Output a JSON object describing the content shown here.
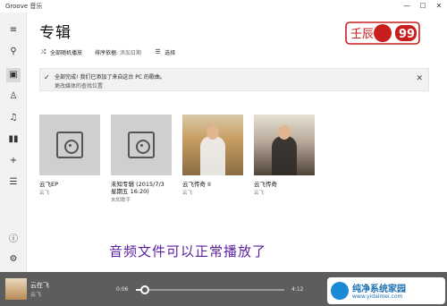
{
  "window": {
    "app_title": "Groove 音乐",
    "controls": [
      "—",
      "☐",
      "✕"
    ]
  },
  "rail": {
    "items": [
      {
        "name": "menu",
        "glyph": "≡"
      },
      {
        "name": "search",
        "glyph": "⚲"
      },
      {
        "name": "albums",
        "glyph": "▣"
      },
      {
        "name": "artists",
        "glyph": "♙"
      },
      {
        "name": "songs",
        "glyph": "♫"
      },
      {
        "name": "now-playing",
        "glyph": "▮▮"
      },
      {
        "name": "new-playlist",
        "glyph": "+"
      },
      {
        "name": "playlists",
        "glyph": "☰"
      },
      {
        "name": "account",
        "glyph": "ⓘ"
      },
      {
        "name": "settings",
        "glyph": "⚙"
      }
    ]
  },
  "page": {
    "title": "专辑"
  },
  "logo": {
    "text_left": "壬辰",
    "text_right": "99",
    "accent": "#c81e1e"
  },
  "commands": {
    "shuffle_label": "全部随机播放",
    "sort_label": "排序依据:",
    "sort_value": "添加日期",
    "select_label": "选择"
  },
  "banner": {
    "message": "全部完成! 我们已添加了来自这台 PC 的歌曲。",
    "sub": "更改媒体的查找位置",
    "close": "✕"
  },
  "albums": [
    {
      "title": "云飞EP",
      "artist": "云飞",
      "cover": "placeholder"
    },
    {
      "title": "未知专辑 (2015/7/3 星期五 16:20)",
      "artist": "未知歌手",
      "cover": "placeholder"
    },
    {
      "title": "云飞传奇 II",
      "artist": "云飞",
      "cover": "photo"
    },
    {
      "title": "云飞传奇",
      "artist": "云飞",
      "cover": "photo"
    }
  ],
  "overlay_caption": "音频文件可以正常播放了",
  "player": {
    "title": "云在飞",
    "artist": "云飞",
    "time_current": "0:06",
    "time_total": "4:12",
    "progress": 0.06
  },
  "watermark": {
    "name": "纯净系统家园",
    "url": "www.yidaimei.com"
  }
}
